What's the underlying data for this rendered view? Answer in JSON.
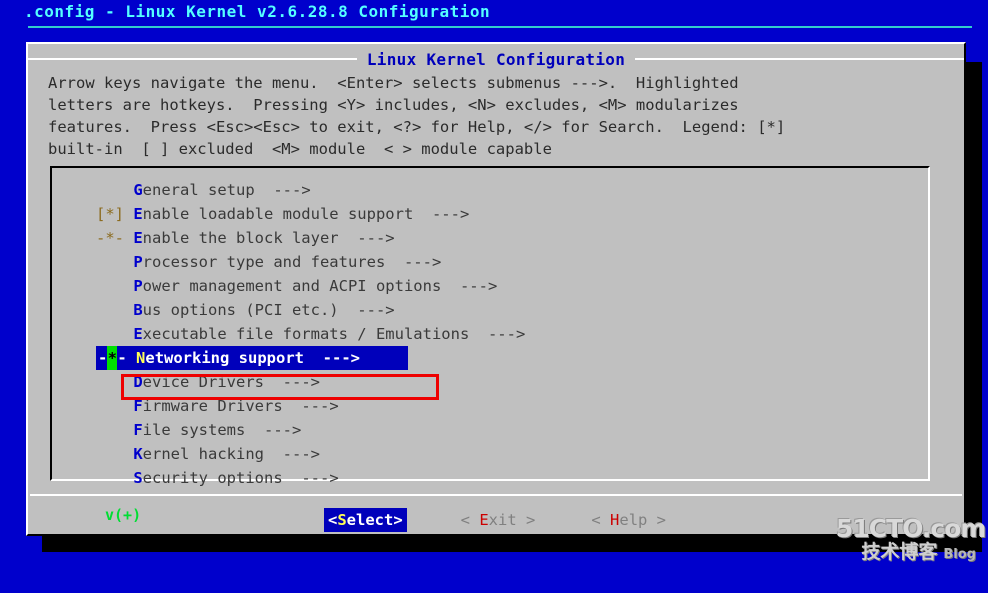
{
  "window": {
    "title": ".config - Linux Kernel v2.6.28.8 Configuration",
    "bg_color": "#0000cc",
    "title_color": "#55ffff"
  },
  "dialog": {
    "title": "Linux Kernel Configuration",
    "title_color": "#0000bb",
    "bg_color": "#c0c0c0",
    "help_lines": [
      "Arrow keys navigate the menu.  <Enter> selects submenus --->.  Highlighted",
      "letters are hotkeys.  Pressing <Y> includes, <N> excludes, <M> modularizes",
      "features.  Press <Esc><Esc> to exit, <?> for Help, </> for Search.  Legend: [*]",
      "built-in  [ ] excluded  <M> module  < > module capable"
    ]
  },
  "menu": {
    "scroll_indicator": "v(+)",
    "scroll_indicator_color": "#00dd33",
    "items": [
      {
        "marker": "   ",
        "hotkey": "G",
        "rest": "eneral setup",
        "arrow": "  --->",
        "selected": false
      },
      {
        "marker": "[*]",
        "hotkey": "E",
        "rest": "nable loadable module support",
        "arrow": "  --->",
        "selected": false
      },
      {
        "marker": "-*-",
        "hotkey": "E",
        "rest": "nable the block layer",
        "arrow": "  --->",
        "selected": false
      },
      {
        "marker": "   ",
        "hotkey": "P",
        "rest": "rocessor type and features",
        "arrow": "  --->",
        "selected": false
      },
      {
        "marker": "   ",
        "hotkey": "P",
        "rest": "ower management and ACPI options",
        "arrow": "  --->",
        "selected": false
      },
      {
        "marker": "   ",
        "hotkey": "B",
        "rest": "us options (PCI etc.)",
        "arrow": "  --->",
        "selected": false
      },
      {
        "marker": "   ",
        "hotkey": "E",
        "rest": "xecutable file formats / Emulations",
        "arrow": "  --->",
        "selected": false
      },
      {
        "marker": "-*-",
        "hotkey": "N",
        "rest": "etworking support",
        "arrow": "  --->",
        "selected": true,
        "cursor_char": "*",
        "cursor_bg": "#00e000",
        "sel_bg": "#0000bb",
        "sel_fg": "#ffffff",
        "sel_hot": "#ffff55"
      },
      {
        "marker": "   ",
        "hotkey": "D",
        "rest": "evice Drivers",
        "arrow": "  --->",
        "selected": false
      },
      {
        "marker": "   ",
        "hotkey": "F",
        "rest": "irmware Drivers",
        "arrow": "  --->",
        "selected": false
      },
      {
        "marker": "   ",
        "hotkey": "F",
        "rest": "ile systems",
        "arrow": "  --->",
        "selected": false
      },
      {
        "marker": "   ",
        "hotkey": "K",
        "rest": "ernel hacking",
        "arrow": "  --->",
        "selected": false
      },
      {
        "marker": "   ",
        "hotkey": "S",
        "rest": "ecurity options",
        "arrow": "  --->",
        "selected": false
      }
    ]
  },
  "buttons": [
    {
      "pre": "<",
      "hotkey": "S",
      "post": "elect>",
      "active": true
    },
    {
      "pre": "< ",
      "hotkey": "E",
      "post": "xit >",
      "active": false
    },
    {
      "pre": "< ",
      "hotkey": "H",
      "post": "elp >",
      "active": false
    }
  ],
  "annotation": {
    "color": "#ee0000",
    "target": "Networking support"
  },
  "watermark": {
    "main": "51CTO.com",
    "cn": "技术博客",
    "blog": "Blog"
  }
}
